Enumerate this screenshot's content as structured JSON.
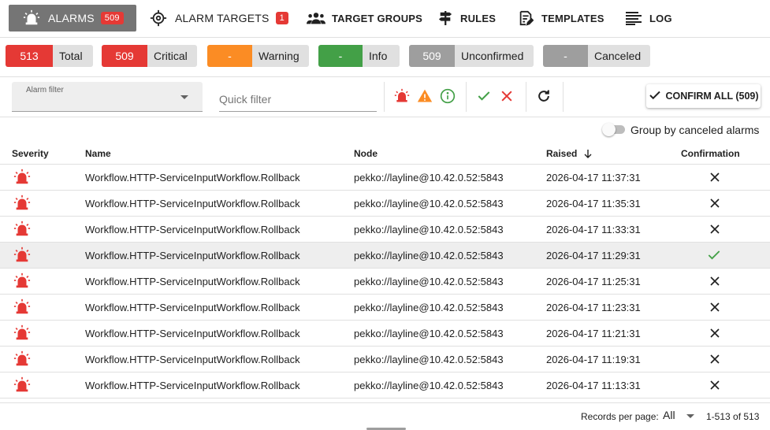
{
  "nav": {
    "tabs": [
      {
        "label": "ALARMS",
        "badge": "509",
        "icon": "siren-icon"
      },
      {
        "label": "ALARM TARGETS",
        "badge": "1",
        "icon": "crosshair-icon"
      },
      {
        "label": "TARGET GROUPS",
        "icon": "people-icon"
      },
      {
        "label": "RULES",
        "icon": "signpost-icon"
      },
      {
        "label": "TEMPLATES",
        "icon": "edit-document-icon"
      },
      {
        "label": "LOG",
        "icon": "list-lines-icon"
      }
    ]
  },
  "summary": [
    {
      "value": "513",
      "label": "Total",
      "color": "#e53935"
    },
    {
      "value": "509",
      "label": "Critical",
      "color": "#e53935"
    },
    {
      "value": "-",
      "label": "Warning",
      "color": "#fb8c24"
    },
    {
      "value": "-",
      "label": "Info",
      "color": "#43a047"
    },
    {
      "value": "509",
      "label": "Unconfirmed",
      "color": "#9e9e9e"
    },
    {
      "value": "-",
      "label": "Canceled",
      "color": "#9e9e9e"
    }
  ],
  "toolbar": {
    "alarm_filter_label": "Alarm filter",
    "quick_filter_placeholder": "Quick filter",
    "confirm_all_label": "CONFIRM ALL (509)"
  },
  "group_toggle_label": "Group by canceled alarms",
  "table": {
    "columns": [
      "Severity",
      "Name",
      "Node",
      "Raised",
      "Confirmation"
    ],
    "sorted_column": "Raised",
    "sort_direction": "descending",
    "rows": [
      {
        "severity": "critical",
        "name": "Workflow.HTTP-ServiceInputWorkflow.Rollback",
        "node": "pekko://layline@10.42.0.52:5843",
        "raised": "2026-04-17 11:37:31",
        "confirmed": false
      },
      {
        "severity": "critical",
        "name": "Workflow.HTTP-ServiceInputWorkflow.Rollback",
        "node": "pekko://layline@10.42.0.52:5843",
        "raised": "2026-04-17 11:35:31",
        "confirmed": false
      },
      {
        "severity": "critical",
        "name": "Workflow.HTTP-ServiceInputWorkflow.Rollback",
        "node": "pekko://layline@10.42.0.52:5843",
        "raised": "2026-04-17 11:33:31",
        "confirmed": false
      },
      {
        "severity": "critical",
        "name": "Workflow.HTTP-ServiceInputWorkflow.Rollback",
        "node": "pekko://layline@10.42.0.52:5843",
        "raised": "2026-04-17 11:29:31",
        "confirmed": true
      },
      {
        "severity": "critical",
        "name": "Workflow.HTTP-ServiceInputWorkflow.Rollback",
        "node": "pekko://layline@10.42.0.52:5843",
        "raised": "2026-04-17 11:25:31",
        "confirmed": false
      },
      {
        "severity": "critical",
        "name": "Workflow.HTTP-ServiceInputWorkflow.Rollback",
        "node": "pekko://layline@10.42.0.52:5843",
        "raised": "2026-04-17 11:23:31",
        "confirmed": false
      },
      {
        "severity": "critical",
        "name": "Workflow.HTTP-ServiceInputWorkflow.Rollback",
        "node": "pekko://layline@10.42.0.52:5843",
        "raised": "2026-04-17 11:21:31",
        "confirmed": false
      },
      {
        "severity": "critical",
        "name": "Workflow.HTTP-ServiceInputWorkflow.Rollback",
        "node": "pekko://layline@10.42.0.52:5843",
        "raised": "2026-04-17 11:19:31",
        "confirmed": false
      },
      {
        "severity": "critical",
        "name": "Workflow.HTTP-ServiceInputWorkflow.Rollback",
        "node": "pekko://layline@10.42.0.52:5843",
        "raised": "2026-04-17 11:13:31",
        "confirmed": false
      }
    ]
  },
  "footer": {
    "records_per_page_label": "Records per page:",
    "records_per_page_value": "All",
    "range_text": "1-513 of 513"
  },
  "colors": {
    "critical": "#e53935",
    "warning": "#fb8c24",
    "info": "#43a047",
    "confirmed": "#43a047",
    "active_tab": "#757575"
  }
}
